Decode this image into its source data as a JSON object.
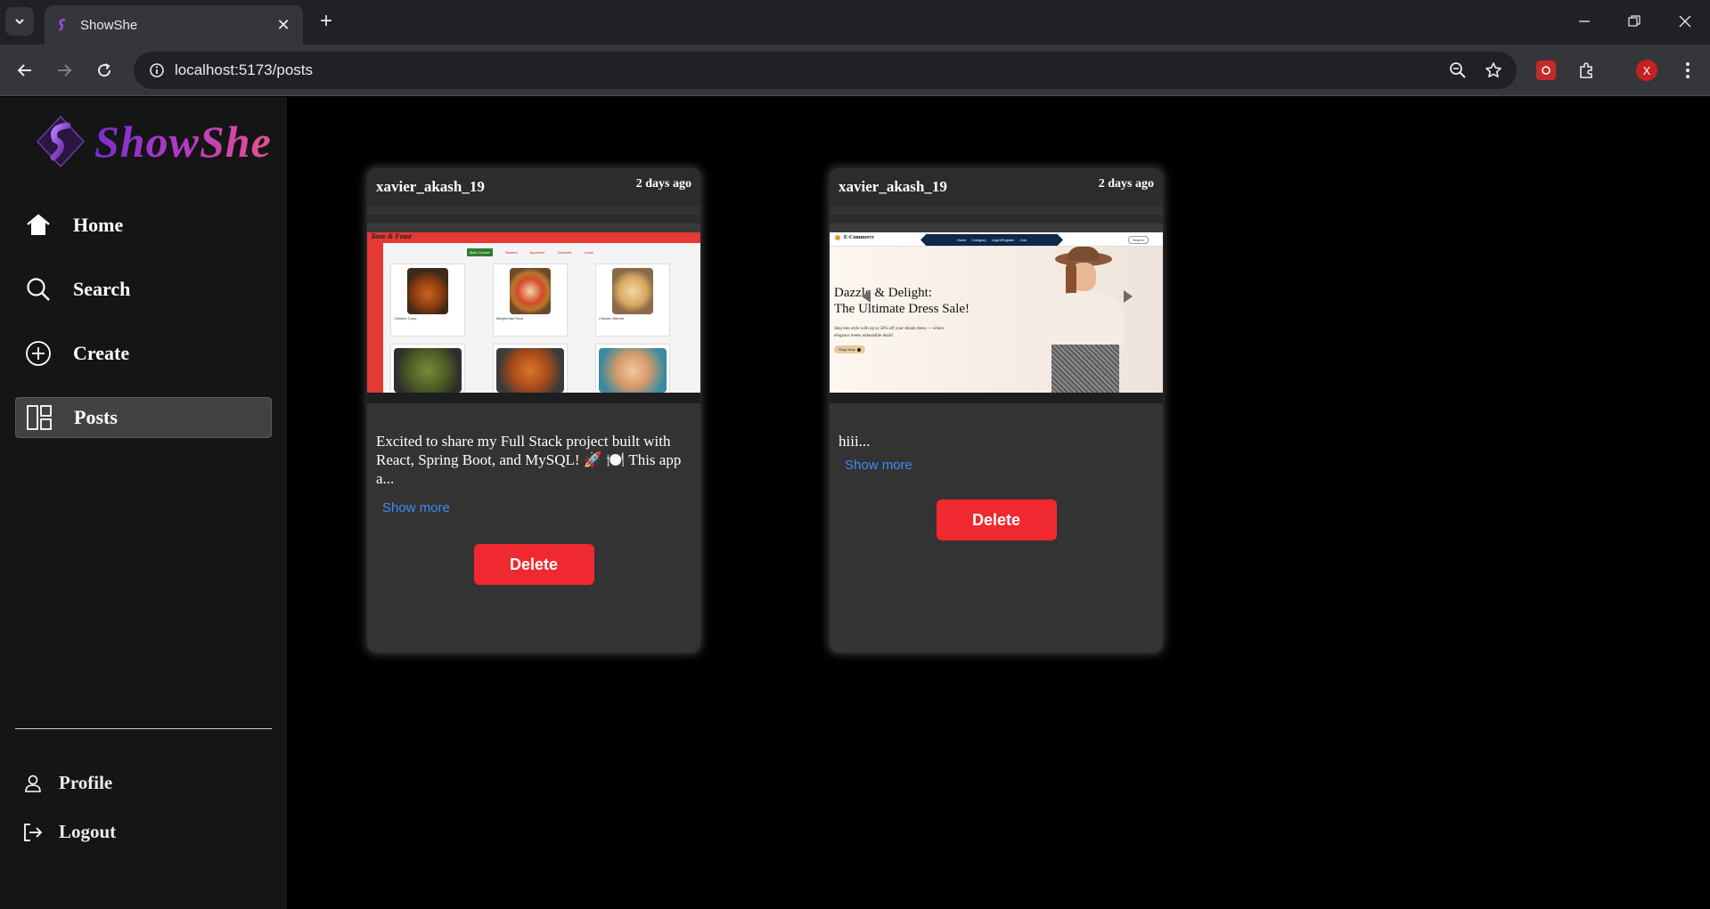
{
  "browser": {
    "tab_title": "ShowShe",
    "url": "localhost:5173/posts",
    "profile_initial": "X"
  },
  "sidebar": {
    "logo_text": "ShowShe",
    "items": [
      {
        "label": "Home",
        "icon": "home-icon"
      },
      {
        "label": "Search",
        "icon": "search-icon"
      },
      {
        "label": "Create",
        "icon": "plus-circle-icon"
      },
      {
        "label": "Posts",
        "icon": "grid-layout-icon",
        "active": true
      }
    ],
    "bottom": [
      {
        "label": "Profile",
        "icon": "user-icon"
      },
      {
        "label": "Logout",
        "icon": "logout-icon"
      }
    ]
  },
  "posts": [
    {
      "username": "xavier_akash_19",
      "time": "2 days ago",
      "caption": "Excited to share my Full Stack project built with React, Spring Boot, and MySQL! 🚀 🍽️ This app a...",
      "show_more": "Show more",
      "delete_label": "Delete",
      "image": {
        "site_title": "Taste & Feast",
        "menu": [
          "Main Course",
          "Starters",
          "Appetizer",
          "Desserts",
          "Lunch"
        ],
        "dishes": [
          "Chicken Curry",
          "Margherita Pizza",
          "Chicken Alfredo"
        ]
      }
    },
    {
      "username": "xavier_akash_19",
      "time": "2 days ago",
      "caption": "hiii...",
      "show_more": "Show more",
      "delete_label": "Delete",
      "image": {
        "site_title": "E-Commerce",
        "nav": [
          "Home",
          "Category",
          "Login/Register",
          "Cart"
        ],
        "search_label": "Search",
        "headline_1": "Dazzle & Delight:",
        "headline_2": "The Ultimate Dress Sale!",
        "subtext": "Step into style with up to 50% off your dream dress — where elegance meets unbeatable deals!",
        "cta": "Shop Now"
      }
    }
  ],
  "colors": {
    "accent_delete": "#f0282f",
    "link": "#3d8bf7",
    "logo_start": "#7a2ccf",
    "logo_end": "#e8508f"
  }
}
